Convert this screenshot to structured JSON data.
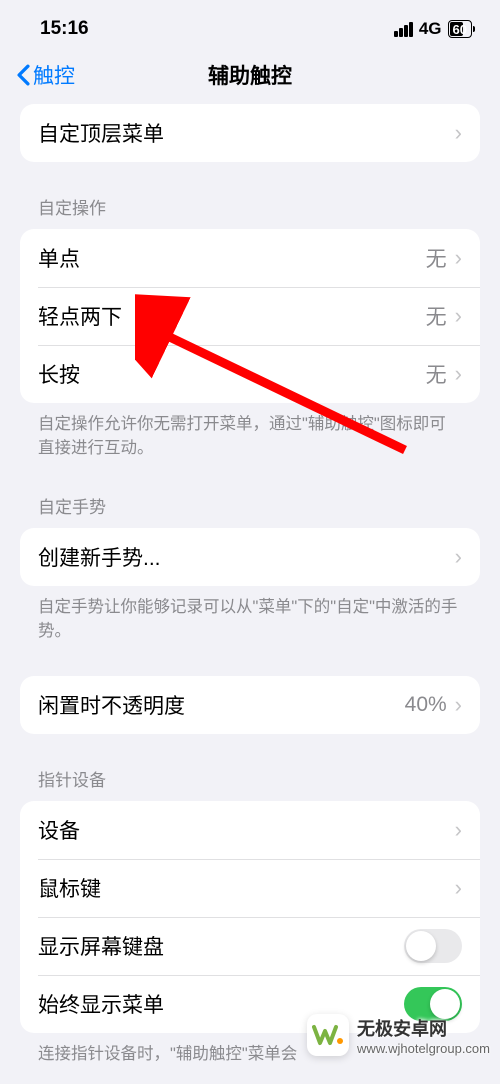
{
  "status": {
    "time": "15:16",
    "network": "4G",
    "battery": "60"
  },
  "nav": {
    "back": "触控",
    "title": "辅助触控"
  },
  "topGroup": {
    "item1": "自定顶层菜单"
  },
  "customActions": {
    "header": "自定操作",
    "single": {
      "label": "单点",
      "value": "无"
    },
    "double": {
      "label": "轻点两下",
      "value": "无"
    },
    "long": {
      "label": "长按",
      "value": "无"
    },
    "footer": "自定操作允许你无需打开菜单，通过\"辅助触控\"图标即可直接进行互动。"
  },
  "customGestures": {
    "header": "自定手势",
    "create": "创建新手势...",
    "footer": "自定手势让你能够记录可以从\"菜单\"下的\"自定\"中激活的手势。"
  },
  "idle": {
    "label": "闲置时不透明度",
    "value": "40%"
  },
  "pointer": {
    "header": "指针设备",
    "devices": "设备",
    "mouseKeys": "鼠标键",
    "showKeyboard": "显示屏幕键盘",
    "alwaysMenu": "始终显示菜单",
    "footer": "连接指针设备时，\"辅助触控\"菜单会"
  },
  "watermark": {
    "name": "无极安卓网",
    "url": "www.wjhotelgroup.com"
  }
}
